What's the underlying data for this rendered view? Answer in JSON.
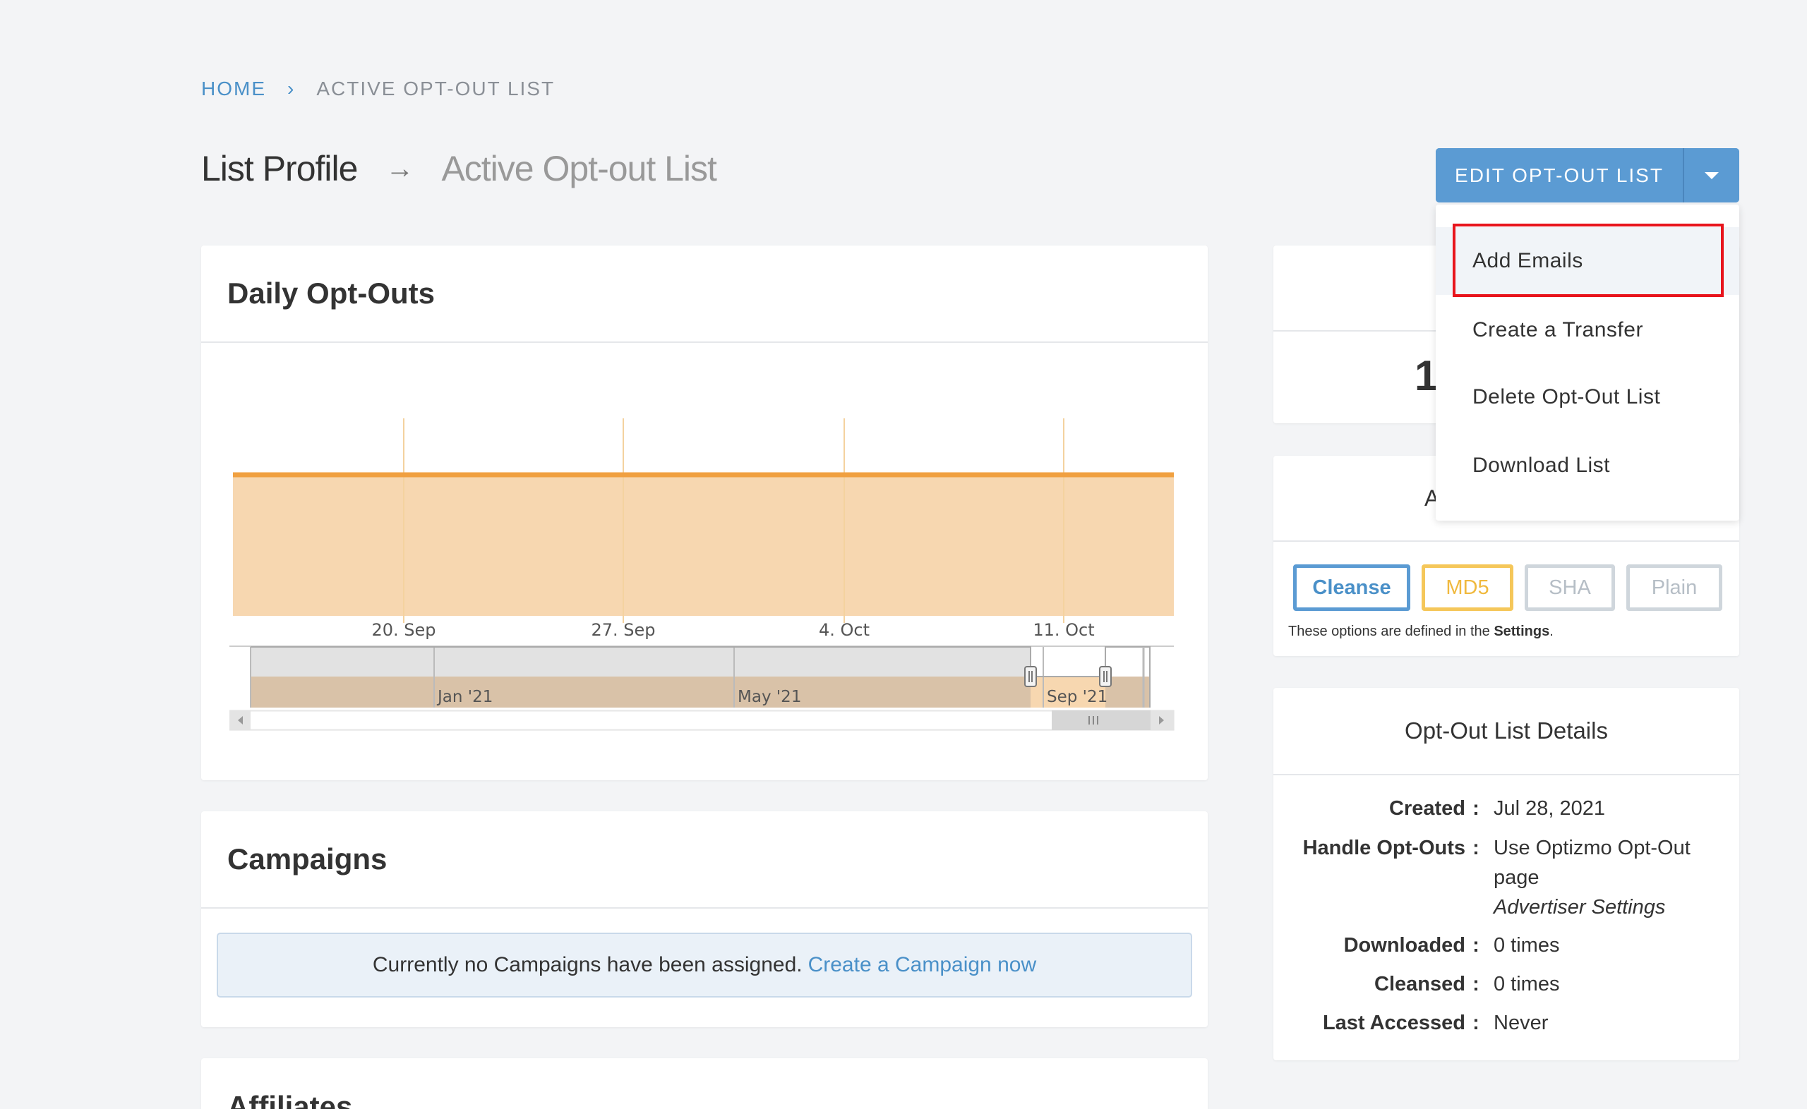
{
  "breadcrumb": {
    "home": "HOME",
    "current": "ACTIVE OPT-OUT LIST"
  },
  "title": {
    "main": "List Profile",
    "sub": "Active Opt-out List"
  },
  "edit_button": {
    "label": "EDIT OPT-OUT LIST"
  },
  "dropdown": {
    "items": [
      "Add Emails",
      "Create a Transfer",
      "Delete Opt-Out List",
      "Download List"
    ]
  },
  "daily_optouts": {
    "title": "Daily Opt-Outs",
    "navigator_labels": [
      "Jan '21",
      "May '21",
      "Sep '21"
    ]
  },
  "chart_data": {
    "type": "area",
    "title": "Daily Opt-Outs",
    "x_ticks": [
      "20. Sep",
      "27. Sep",
      "4. Oct",
      "11. Oct"
    ],
    "series": [
      {
        "values": [
          1,
          1,
          1,
          1,
          1
        ]
      }
    ],
    "colors": {
      "line": "#f0a040",
      "fill": "#f7d7b0",
      "grid": "#f7dcb0"
    }
  },
  "campaigns": {
    "title": "Campaigns",
    "note": "Currently no Campaigns have been assigned.",
    "link": "Create a Campaign now"
  },
  "affiliates": {
    "title": "Affiliates"
  },
  "stats": {
    "partial_value": "1",
    "partial_letter": "A"
  },
  "formats": {
    "buttons": [
      "Cleanse",
      "MD5",
      "SHA",
      "Plain"
    ],
    "note_prefix": "These options are defined in the ",
    "note_link": "Settings",
    "note_suffix": "."
  },
  "details": {
    "title": "Opt-Out List Details",
    "created_label": "Created",
    "created_value": "Jul 28, 2021",
    "handle_label": "Handle Opt-Outs",
    "handle_value_1": "Use Optizmo Opt-Out",
    "handle_value_2": "page",
    "handle_value_3": "Advertiser Settings",
    "downloaded_label": "Downloaded",
    "downloaded_value": "0 times",
    "cleansed_label": "Cleansed",
    "cleansed_value": "0 times",
    "accessed_label": "Last Accessed",
    "accessed_value": "Never"
  }
}
